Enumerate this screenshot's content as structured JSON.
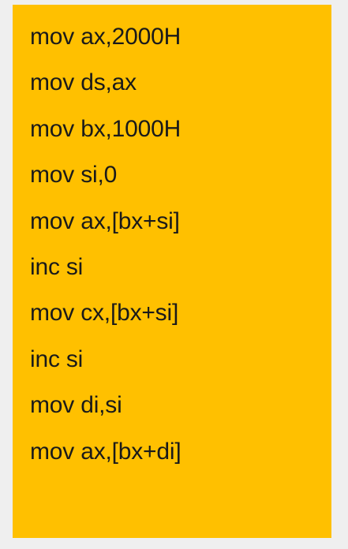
{
  "code_block": {
    "background_color": "#ffc000",
    "text_color": "#1a1a1a",
    "lines": [
      "mov ax,2000H",
      "mov ds,ax",
      "mov bx,1000H",
      "mov si,0",
      "mov ax,[bx+si]",
      "inc si",
      "mov cx,[bx+si]",
      "inc si",
      "mov di,si",
      "mov ax,[bx+di]"
    ]
  }
}
